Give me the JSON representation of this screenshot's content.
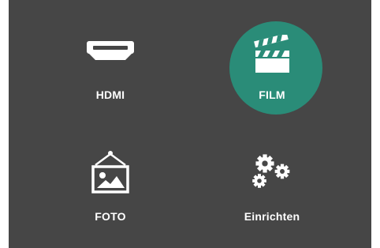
{
  "menu": {
    "items": [
      {
        "label": "HDMI",
        "icon": "hdmi-icon",
        "selected": false
      },
      {
        "label": "FILM",
        "icon": "clapperboard-icon",
        "selected": true
      },
      {
        "label": "FOTO",
        "icon": "photo-icon",
        "selected": false
      },
      {
        "label": "Einrichten",
        "icon": "gears-icon",
        "selected": false
      }
    ],
    "selected_color": "#2a8c78",
    "background_color": "#464646"
  }
}
